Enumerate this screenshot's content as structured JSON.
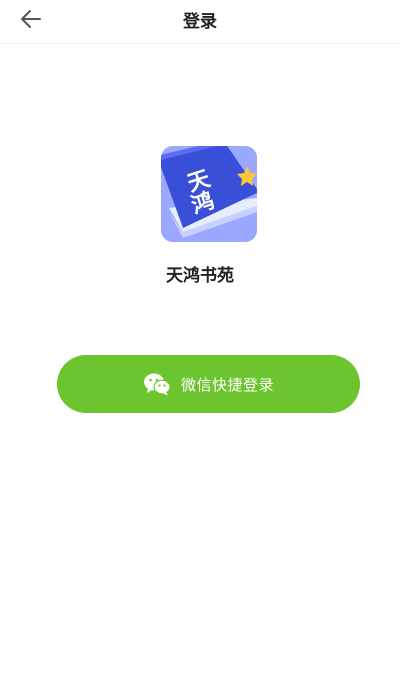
{
  "header": {
    "title": "登录",
    "back_icon": "arrow-left-icon"
  },
  "app": {
    "logo_text": "天鸿",
    "name": "天鸿书苑"
  },
  "login": {
    "wechat_label": "微信快捷登录",
    "icon": "wechat-icon"
  },
  "colors": {
    "accent_green": "#6cc52e",
    "logo_blue": "#3a4fd8",
    "logo_bg": "#9aa8ff",
    "star_yellow": "#ffc53a"
  }
}
